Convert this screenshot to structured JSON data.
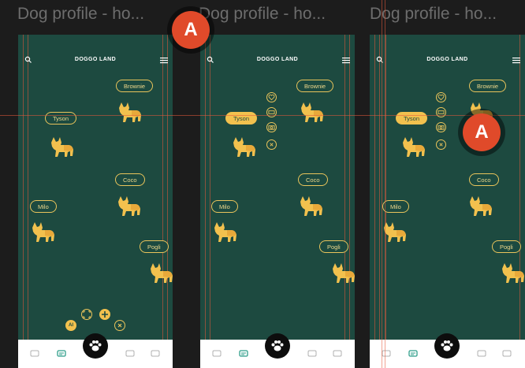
{
  "frames": [
    {
      "title": "Dog profile - ho...",
      "brand": "DOGGO LAND",
      "show_actions": false
    },
    {
      "title": "Dog profile - ho...",
      "brand": "DOGGO LAND",
      "show_actions": true
    },
    {
      "title": "Dog profile - ho...",
      "brand": "DOGGO LAND",
      "show_actions": true
    }
  ],
  "dogs": [
    "Brownie",
    "Tyson",
    "Coco",
    "Milo",
    "Pogli"
  ],
  "fab_menu": {
    "ai_label": "AI"
  },
  "cursor_avatars": [
    {
      "initial": "A"
    },
    {
      "initial": "A"
    }
  ],
  "colors": {
    "canvas": "#1c1c1c",
    "frame_bg": "#1d4a40",
    "accent": "#f2c14e",
    "avatar": "#e04a2a"
  },
  "icons": [
    "search-icon",
    "menu-icon",
    "heart-icon",
    "ticket-icon",
    "camera-icon",
    "close-icon",
    "chat-icon",
    "paw-icon",
    "scan-icon",
    "plus-icon",
    "dog-icon"
  ]
}
